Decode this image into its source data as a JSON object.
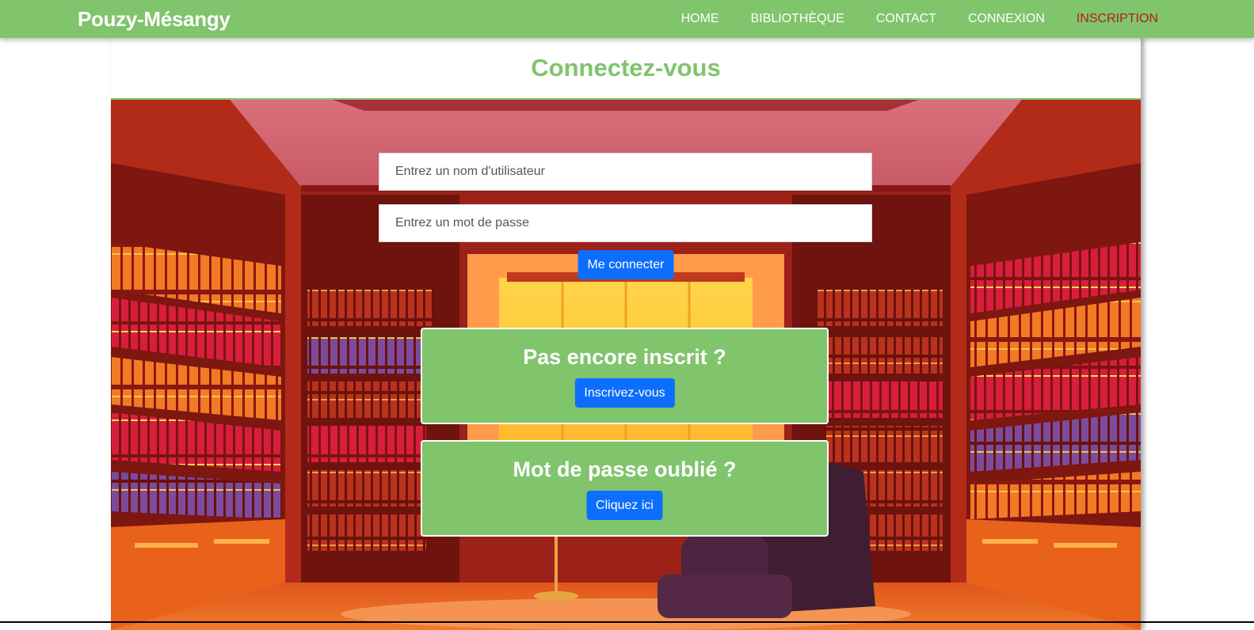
{
  "brand": "Pouzy-Mésangy",
  "nav": {
    "home": "HOME",
    "library": "BIBLIOTHÈQUE",
    "contact": "CONTACT",
    "login": "CONNEXION",
    "signup": "INSCRIPTION"
  },
  "page_title": "Connectez-vous",
  "form": {
    "username_placeholder": "Entrez un nom d'utilisateur",
    "password_placeholder": "Entrez un mot de passe",
    "submit_label": "Me connecter"
  },
  "signup_card": {
    "title": "Pas encore inscrit ?",
    "button_label": "Inscrivez-vous"
  },
  "forgot_card": {
    "title": "Mot de passe oublié ?",
    "button_label": "Cliquez ici"
  },
  "colors": {
    "brand_green": "#80c46c",
    "active_nav": "#b21f14",
    "primary_button": "#0d6efd"
  }
}
